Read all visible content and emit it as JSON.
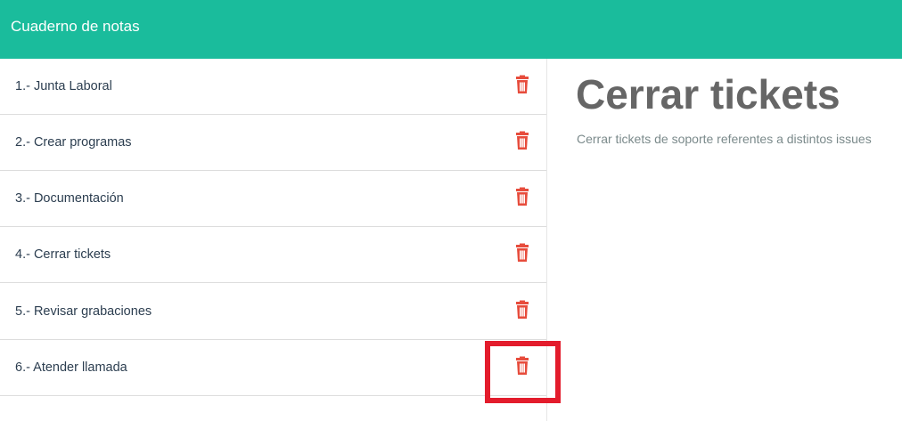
{
  "app": {
    "title": "Cuaderno de notas"
  },
  "colors": {
    "navbar": "#1abc9c",
    "delete": "#e74c3c",
    "highlight": "#e31c2c"
  },
  "notes": [
    {
      "label": "1.- Junta Laboral",
      "icon": "trash-icon"
    },
    {
      "label": "2.- Crear programas",
      "icon": "trash-icon"
    },
    {
      "label": "3.- Documentación",
      "icon": "trash-icon"
    },
    {
      "label": "4.- Cerrar tickets",
      "icon": "trash-icon"
    },
    {
      "label": "5.- Revisar grabaciones",
      "icon": "trash-icon"
    },
    {
      "label": "6.- Atender llamada",
      "icon": "trash-icon"
    }
  ],
  "detail": {
    "title": "Cerrar tickets",
    "body": "Cerrar tickets de soporte referentes a distintos issues"
  }
}
